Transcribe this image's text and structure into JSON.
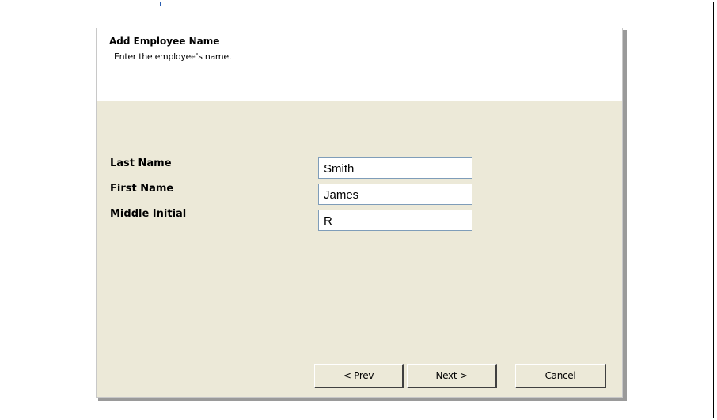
{
  "wizard": {
    "title": "Add Employee Name",
    "subtitle": "Enter the employee's name."
  },
  "fields": [
    {
      "label": "Last Name",
      "value": "Smith"
    },
    {
      "label": "First Name",
      "value": "James"
    },
    {
      "label": "Middle Initial",
      "value": "R"
    }
  ],
  "buttons": {
    "prev": "< Prev",
    "next": "Next >",
    "cancel": "Cancel"
  }
}
